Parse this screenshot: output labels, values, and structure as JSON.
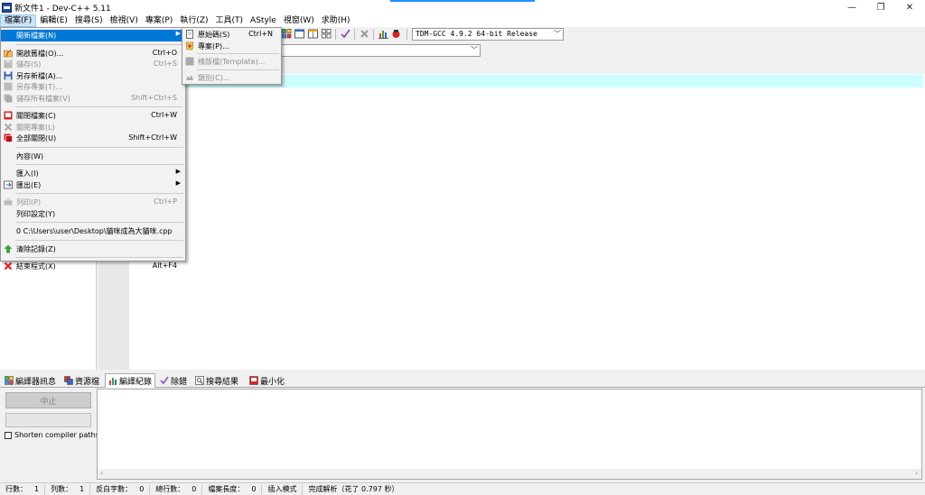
{
  "window": {
    "title": "新文件1 - Dev-C++ 5.11",
    "controls": {
      "minimize": "—",
      "maximize": "❐",
      "close": "✕"
    }
  },
  "colors": {
    "menu_highlight": "#0078d7",
    "current_line": "#ccffff",
    "title_accent": "#1e90ff",
    "clear_icon": "#3aa53a",
    "exit_icon": "#e02020"
  },
  "menubar": {
    "items": [
      "檔案(F)",
      "編輯(E)",
      "搜尋(S)",
      "檢視(V)",
      "專案(P)",
      "執行(Z)",
      "工具(T)",
      "AStyle",
      "視窗(W)",
      "求助(H)"
    ]
  },
  "toolbar": {
    "compiler": "TDM-GCC 4.9.2 64-bit Release"
  },
  "file_menu": {
    "new": {
      "label": "開新檔案(N)"
    },
    "open": {
      "label": "開啟舊檔(O)...",
      "shortcut": "Ctrl+O"
    },
    "save": {
      "label": "儲存(S)",
      "shortcut": "Ctrl+S"
    },
    "save_as": {
      "label": "另存新檔(A)..."
    },
    "save_project_as": {
      "label": "另存專案(T)..."
    },
    "save_all": {
      "label": "儲存所有檔案(V)",
      "shortcut": "Shift+Ctrl+S"
    },
    "close": {
      "label": "關閉檔案(C)",
      "shortcut": "Ctrl+W"
    },
    "close_project": {
      "label": "關閉專案(L)"
    },
    "close_all": {
      "label": "全部關閉(U)",
      "shortcut": "Shift+Ctrl+W"
    },
    "properties": {
      "label": "內容(W)"
    },
    "import": {
      "label": "匯入(I)"
    },
    "export": {
      "label": "匯出(E)"
    },
    "print": {
      "label": "列印(P)",
      "shortcut": "Ctrl+P"
    },
    "print_setup": {
      "label": "列印設定(Y)"
    },
    "recent": {
      "label": "0 C:\\Users\\user\\Desktop\\貓咪成為大貓咪.cpp"
    },
    "clear_history": {
      "label": "清除記錄(Z)"
    },
    "exit": {
      "label": "結束程式(X)",
      "shortcut": "Alt+F4"
    }
  },
  "new_submenu": {
    "source": {
      "label": "原始碼(S)",
      "shortcut": "Ctrl+N"
    },
    "project": {
      "label": "專案(P)..."
    },
    "template": {
      "label": "樣版檔(Template)..."
    },
    "class": {
      "label": "類別(C)..."
    }
  },
  "bottom_tabs": [
    "編譯器訊息",
    "資源檔",
    "編譯紀錄",
    "除錯",
    "搜尋結果",
    "最小化"
  ],
  "compile_panel": {
    "abort_label": "中止",
    "shorten_label": "Shorten compiler paths"
  },
  "statusbar": {
    "line_label": "行數：",
    "line_value": "1",
    "col_label": "列數：",
    "col_value": "1",
    "sel_label": "反白字數：",
    "sel_value": "0",
    "lines_label": "總行數：",
    "lines_value": "0",
    "length_label": "檔案長度：",
    "length_value": "0",
    "mode": "插入模式",
    "parse": "完成解析（花了 0.797 秒）"
  }
}
